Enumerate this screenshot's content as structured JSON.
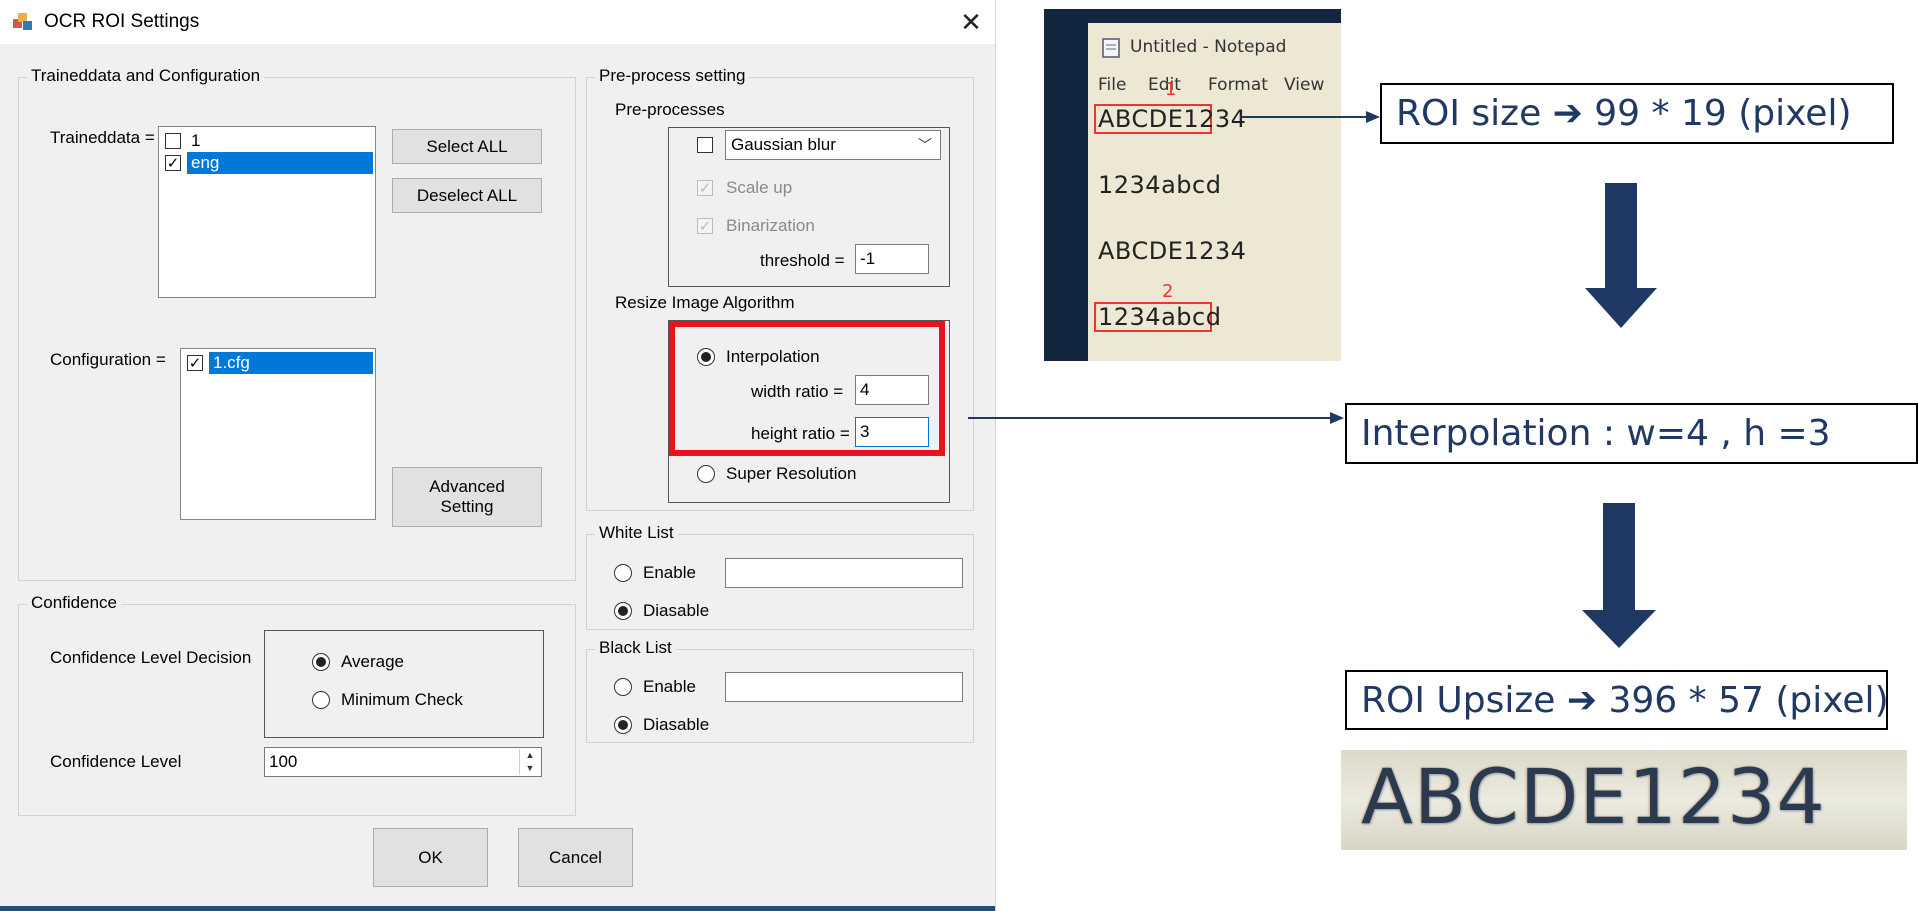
{
  "dialog": {
    "title": "OCR ROI Settings",
    "close_glyph": "✕",
    "traineddata_group": {
      "label": "Traineddata and Configuration",
      "traineddata_label": "Traineddata =",
      "traineddata_items": [
        {
          "label": "1",
          "checked": false,
          "selected": false
        },
        {
          "label": "eng",
          "checked": true,
          "selected": true
        }
      ],
      "select_all_label": "Select ALL",
      "deselect_all_label": "Deselect ALL",
      "configuration_label": "Configuration =",
      "configuration_items": [
        {
          "label": "1.cfg",
          "checked": true,
          "selected": true
        }
      ],
      "advanced_label": "Advanced\nSetting"
    },
    "preprocess_group": {
      "label": "Pre-process setting",
      "preprocesses_label": "Pre-processes",
      "blur_checked": false,
      "blur_value": "Gaussian blur",
      "scale_up_label": "Scale up",
      "scale_up_checked": true,
      "binarization_label": "Binarization",
      "binarization_checked": true,
      "threshold_label": "threshold =",
      "threshold_value": "-1",
      "resize_label": "Resize Image Algorithm",
      "interpolation_label": "Interpolation",
      "interpolation_selected": true,
      "width_ratio_label": "width ratio =",
      "width_ratio_value": "4",
      "height_ratio_label": "height ratio =",
      "height_ratio_value": "3",
      "super_resolution_label": "Super Resolution",
      "super_resolution_selected": false
    },
    "white_list": {
      "label": "White List",
      "enable_label": "Enable",
      "disable_label": "Diasable",
      "selected": "disable",
      "value": ""
    },
    "black_list": {
      "label": "Black List",
      "enable_label": "Enable",
      "disable_label": "Diasable",
      "selected": "disable",
      "value": ""
    },
    "confidence": {
      "label": "Confidence",
      "decision_label": "Confidence Level Decision",
      "average_label": "Average",
      "minimum_label": "Minimum Check",
      "selected": "average",
      "level_label": "Confidence Level",
      "level_value": "100"
    },
    "ok_label": "OK",
    "cancel_label": "Cancel"
  },
  "notepad": {
    "title": "Untitled - Notepad",
    "menu": [
      "File",
      "Edit",
      "Format",
      "View"
    ],
    "lines": [
      "ABCDE1234",
      "1234abcd",
      "ABCDE1234",
      "1234abcd"
    ],
    "marks": [
      "1",
      "2"
    ]
  },
  "annotations": {
    "roi_size": "ROI size ➔ 99 * 19 (pixel)",
    "interpolation": "Interpolation : w=4 , h =3",
    "roi_upsize": "ROI Upsize ➔ 396 * 57 (pixel)",
    "upsized_text": "ABCDE1234"
  },
  "colors": {
    "annotation_text": "#1f3864",
    "arrow": "#1f3864",
    "highlight": "#e8131c",
    "selection": "#0078d7"
  }
}
